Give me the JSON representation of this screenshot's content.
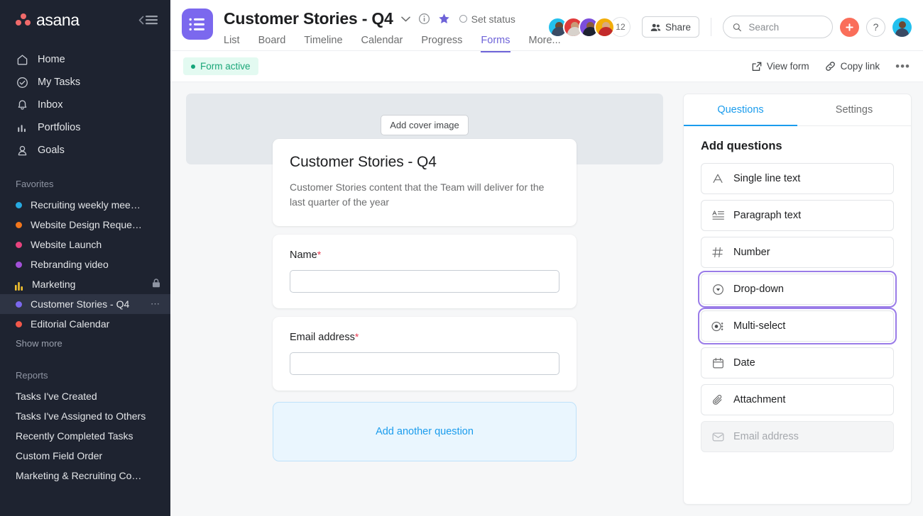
{
  "sidebar": {
    "brand": "asana",
    "nav": [
      {
        "label": "Home",
        "icon": "home-icon"
      },
      {
        "label": "My Tasks",
        "icon": "check-circle-icon"
      },
      {
        "label": "Inbox",
        "icon": "bell-icon"
      },
      {
        "label": "Portfolios",
        "icon": "bar-chart-icon"
      },
      {
        "label": "Goals",
        "icon": "goals-icon"
      }
    ],
    "favorites_title": "Favorites",
    "favorites": [
      {
        "label": "Recruiting weekly mee…",
        "color": "#26a9e0",
        "selected": false,
        "lock": false,
        "menu": false
      },
      {
        "label": "Website Design Reque…",
        "color": "#f2761b",
        "selected": false,
        "lock": false,
        "menu": false
      },
      {
        "label": "Website Launch",
        "color": "#e8437e",
        "selected": false,
        "lock": false,
        "menu": false
      },
      {
        "label": "Rebranding video",
        "color": "#a250d8",
        "selected": false,
        "lock": false,
        "menu": false
      },
      {
        "label": "Marketing",
        "color": "#f2c12e",
        "selected": false,
        "lock": true,
        "menu": false,
        "icon": "bar-chart-icon"
      },
      {
        "label": "Customer Stories - Q4",
        "color": "#7b68ee",
        "selected": true,
        "lock": false,
        "menu": true
      },
      {
        "label": "Editorial Calendar",
        "color": "#f2584a",
        "selected": false,
        "lock": false,
        "menu": false
      }
    ],
    "show_more": "Show more",
    "reports_title": "Reports",
    "reports": [
      "Tasks I've Created",
      "Tasks I've Assigned to Others",
      "Recently Completed Tasks",
      "Custom Field Order",
      "Marketing & Recruiting Co…"
    ]
  },
  "header": {
    "project_title": "Customer Stories - Q4",
    "set_status": "Set status",
    "tabs": [
      {
        "label": "List",
        "active": false
      },
      {
        "label": "Board",
        "active": false
      },
      {
        "label": "Timeline",
        "active": false
      },
      {
        "label": "Calendar",
        "active": false
      },
      {
        "label": "Progress",
        "active": false
      },
      {
        "label": "Forms",
        "active": true
      },
      {
        "label": "More...",
        "active": false
      }
    ],
    "member_count": "12",
    "share_label": "Share",
    "help_label": "?",
    "avatar_colors": [
      "#23c0ee",
      "#e03a3a",
      "#7b4ddb",
      "#f2ad0a"
    ],
    "accent_purple": "#6e63d8",
    "plus_color": "#fa6e5a"
  },
  "search": {
    "placeholder": "Search",
    "value": ""
  },
  "subbar": {
    "status_badge": "Form active",
    "view_form": "View form",
    "copy_link": "Copy link",
    "more": "•••"
  },
  "form": {
    "add_cover": "Add cover image",
    "title": "Customer Stories - Q4",
    "description": "Customer Stories content that the Team will deliver for the last quarter of the year",
    "questions": [
      {
        "label": "Name",
        "required": true,
        "value": "",
        "placeholder": ""
      },
      {
        "label": "Email address",
        "required": true,
        "value": "",
        "placeholder": ""
      }
    ],
    "required_mark": "*",
    "add_another": "Add another question"
  },
  "panel": {
    "tabs": [
      {
        "label": "Questions",
        "active": true
      },
      {
        "label": "Settings",
        "active": false
      }
    ],
    "section_title": "Add questions",
    "highlight_color": "#9a7ce8",
    "question_types": [
      {
        "label": "Single line text",
        "icon": "letter-a-icon",
        "highlighted": false,
        "disabled": false
      },
      {
        "label": "Paragraph text",
        "icon": "paragraph-icon",
        "highlighted": false,
        "disabled": false
      },
      {
        "label": "Number",
        "icon": "hash-icon",
        "highlighted": false,
        "disabled": false
      },
      {
        "label": "Drop-down",
        "icon": "dropdown-circle-icon",
        "highlighted": true,
        "disabled": false
      },
      {
        "label": "Multi-select",
        "icon": "multi-select-icon",
        "highlighted": true,
        "disabled": false
      },
      {
        "label": "Date",
        "icon": "calendar-icon",
        "highlighted": false,
        "disabled": false
      },
      {
        "label": "Attachment",
        "icon": "paperclip-icon",
        "highlighted": false,
        "disabled": false
      },
      {
        "label": "Email address",
        "icon": "envelope-icon",
        "highlighted": false,
        "disabled": true
      }
    ]
  }
}
